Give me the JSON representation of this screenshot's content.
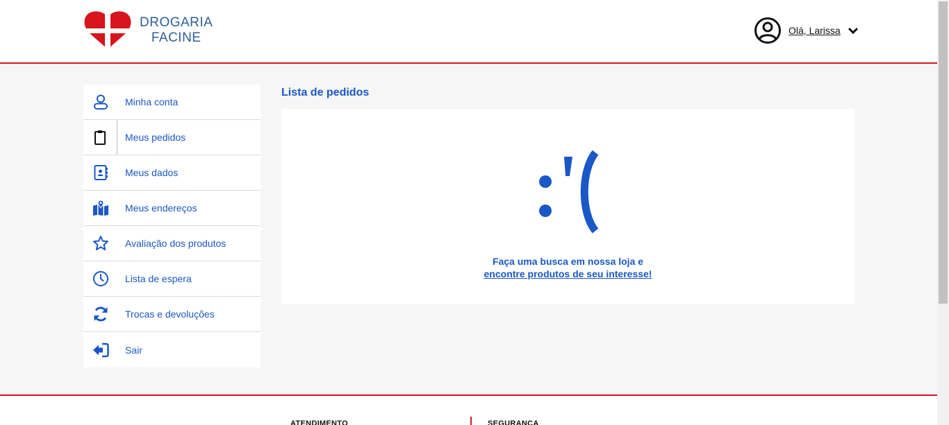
{
  "brand": {
    "line1": "DROGARIA",
    "line2": "FACINE",
    "accent": "#d8141c",
    "primary": "#1a57c7"
  },
  "user": {
    "greeting": "Olá, Larissa",
    "avatar_icon": "user-circle-icon",
    "menu_icon": "chevron-down-icon"
  },
  "sidebar": {
    "items": [
      {
        "label": "Minha conta",
        "icon": "user-icon"
      },
      {
        "label": "Meus pedidos",
        "icon": "clipboard-icon"
      },
      {
        "label": "Meus dados",
        "icon": "contact-card-icon"
      },
      {
        "label": "Meus endereços",
        "icon": "map-pin-icon"
      },
      {
        "label": "Avaliação dos produtos",
        "icon": "star-icon"
      },
      {
        "label": "Lista de espera",
        "icon": "clock-icon"
      },
      {
        "label": "Trocas e devoluções",
        "icon": "refresh-icon"
      },
      {
        "label": "Sair",
        "icon": "logout-icon"
      }
    ],
    "active_index": 1
  },
  "main": {
    "title": "Lista de pedidos",
    "empty": {
      "line1": "Faça uma busca em nossa loja e",
      "link": "encontre produtos de seu interesse!"
    }
  },
  "footer": {
    "col1": "ATENDIMENTO",
    "col2": "SEGURANÇA"
  }
}
